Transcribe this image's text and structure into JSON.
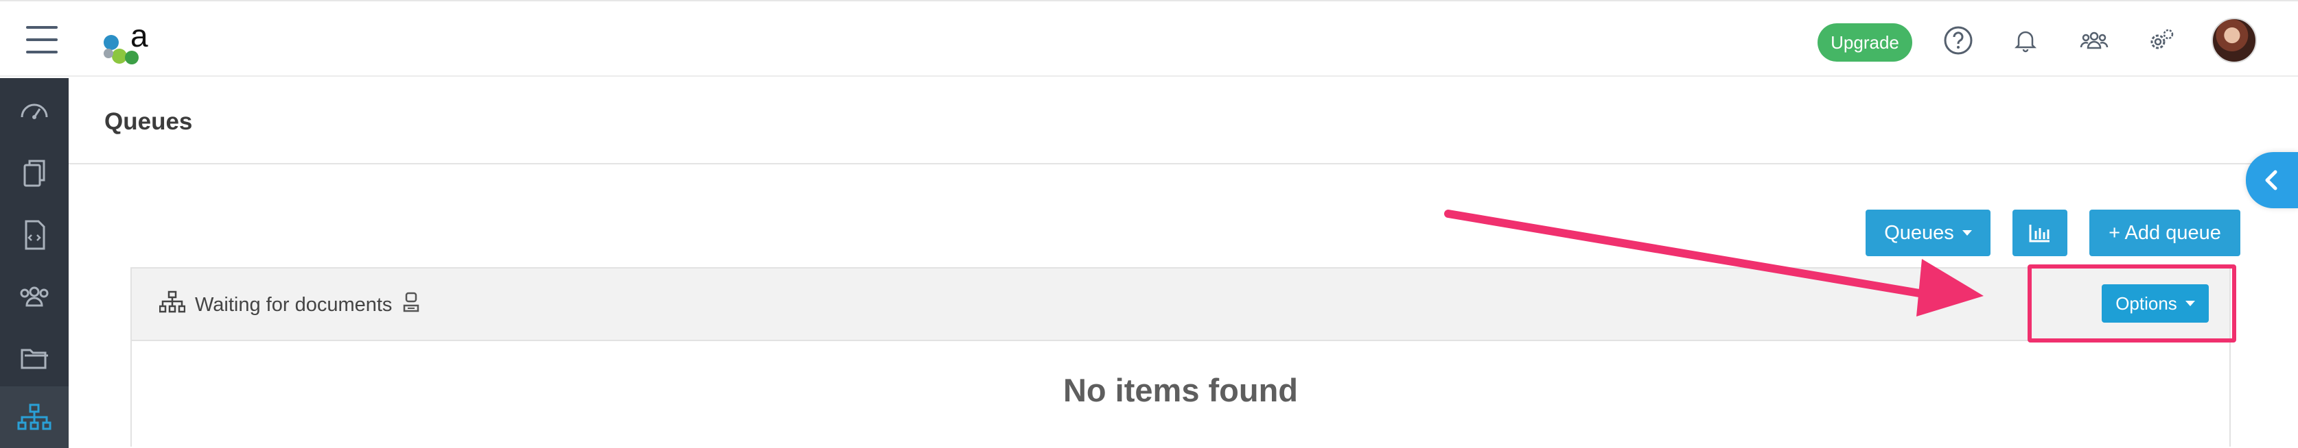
{
  "header": {
    "upgrade_label": "Upgrade",
    "icons": [
      "menu-icon",
      "help-icon",
      "bell-icon",
      "users-icon",
      "settings-icon"
    ],
    "brand_color": "#45b665"
  },
  "sidebar": {
    "items": [
      {
        "icon": "dashboard-icon"
      },
      {
        "icon": "documents-icon"
      },
      {
        "icon": "code-file-icon"
      },
      {
        "icon": "users-icon"
      },
      {
        "icon": "folder-icon"
      },
      {
        "icon": "queues-icon",
        "active": true
      }
    ],
    "background": "#2f3640",
    "active_color": "#2aa0d6"
  },
  "page": {
    "title": "Queues"
  },
  "toolbar": {
    "queues_label": "Queues",
    "add_queue_label": "+ Add queue",
    "accent": "#2aa0d6"
  },
  "queue": {
    "name": "Waiting for documents",
    "options_label": "Options",
    "empty_message": "No items found"
  },
  "annotation": {
    "color": "#f0306e"
  }
}
